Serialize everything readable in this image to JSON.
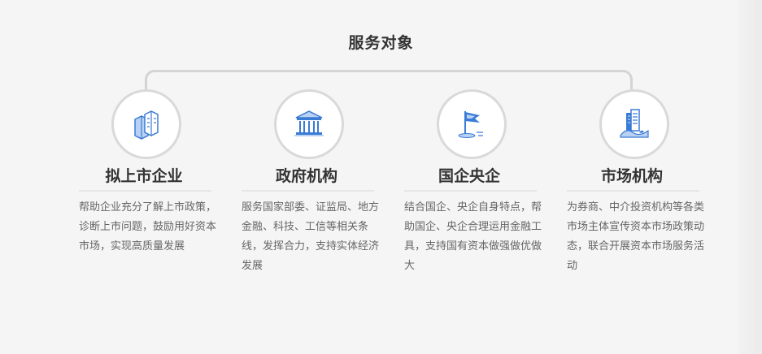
{
  "section_title": "服务对象",
  "colors": {
    "icon_blue": "#3a7bd5",
    "icon_light": "#b9d2f3",
    "circle_border": "#d9d9d9",
    "connector": "#d4d4d4"
  },
  "cards": [
    {
      "icon": "buildings-icon",
      "title": "拟上市企业",
      "desc": "帮助企业充分了解上市政策，诊断上市问题，鼓励用好资本市场，实现高质量发展"
    },
    {
      "icon": "government-building-icon",
      "title": "政府机构",
      "desc": "服务国家部委、证监局、地方金融、科技、工信等相关条线，发挥合力，支持实体经济发展"
    },
    {
      "icon": "flag-icon",
      "title": "国企央企",
      "desc": "结合国企、央企自身特点，帮助国企、央企合理运用金融工具，支持国有资本做强做优做大"
    },
    {
      "icon": "market-institution-icon",
      "title": "市场机构",
      "desc": "为券商、中介投资机构等各类市场主体宣传资本市场政策动态，联合开展资本市场服务活动"
    }
  ]
}
